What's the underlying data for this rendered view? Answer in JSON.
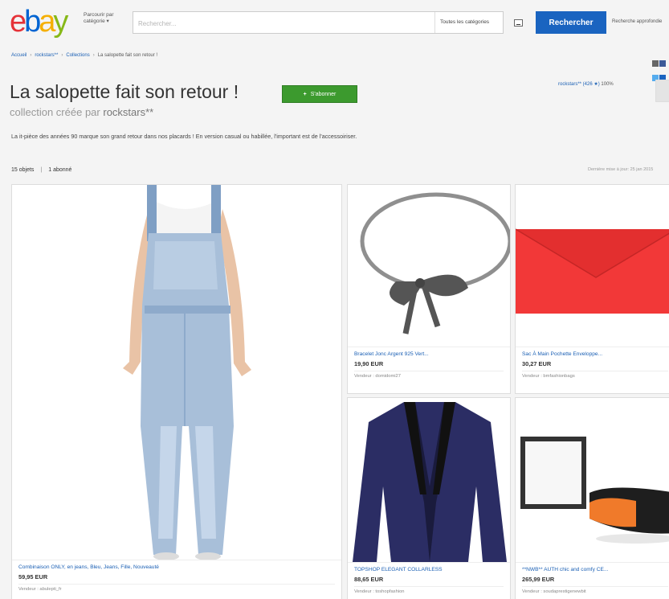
{
  "header": {
    "logo_letters": [
      "e",
      "b",
      "a",
      "y"
    ],
    "logo_colors": [
      "#e53238",
      "#0064d2",
      "#f5af02",
      "#86b817"
    ],
    "shop_by_category": "Parcourir par catégorie ▾",
    "search_placeholder": "Rechercher...",
    "category_select": "Toutes les catégories",
    "search_button": "Rechercher",
    "advanced_search": "Recherche approfondie"
  },
  "breadcrumb": {
    "home": "Accueil",
    "user": "rockstars**",
    "collections": "Collections",
    "current": "La salopette fait son retour !"
  },
  "share_icons": [
    {
      "name": "email-icon",
      "color": "#666666"
    },
    {
      "name": "facebook-icon",
      "color": "#3b5998"
    },
    {
      "name": "twitter-icon",
      "color": "#55acee"
    },
    {
      "name": "pinterest-icon",
      "color": "#1a64c0"
    }
  ],
  "collection": {
    "title": "La salopette fait son retour !",
    "follow_button": "S'abonner",
    "created_by_prefix": "collection créée par",
    "created_by_user": "rockstars**",
    "seller_info": "rockstars** (426 ★)",
    "seller_rating": "100%",
    "description": "La it-pièce des années 90 marque son grand retour dans nos placards ! En version casual ou habillée, l'important est de l'accessoiriser.",
    "items_count": "15 objets",
    "followers_count": "1 abonné",
    "last_update": "Dernière mise à jour: 25 jan 2015"
  },
  "products": [
    {
      "title": "Combinaison ONLY, en jeans, Bleu, Jeans, Fille, Nouveauté",
      "price": "59,95 EUR",
      "seller": "Vendeur : abulepti_fr"
    },
    {
      "title": "Bracelet Jonc Argent 925 Vert...",
      "price": "19,90 EUR",
      "seller": "Vendeur : domidomi27"
    },
    {
      "title": "Sac À Main Pochette Enveloppe...",
      "price": "30,27 EUR",
      "seller": "Vendeur : bmfashionbags"
    },
    {
      "title": "TOPSHOP ELEGANT COLLARLESS",
      "price": "88,65 EUR",
      "seller": "Vendeur : toshopfashion"
    },
    {
      "title": "**NWB** AUTH chic and comfy CE...",
      "price": "265,99 EUR",
      "seller": "Vendeur : soudaprestigenewbit"
    }
  ]
}
